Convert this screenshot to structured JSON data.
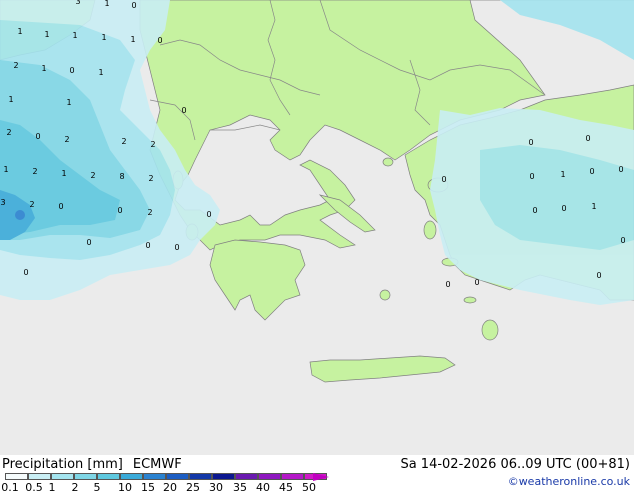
{
  "title": {
    "variable": "Precipitation [mm]",
    "model": "ECMWF"
  },
  "run_info": "Sa 14-02-2026 06..09 UTC (00+81)",
  "credit": "©weatheronline.co.uk",
  "legend": {
    "ticks": [
      "0.1",
      "0.5",
      "1",
      "2",
      "5",
      "10",
      "15",
      "20",
      "25",
      "30",
      "35",
      "40",
      "45",
      "50"
    ],
    "colors": [
      "#f5fbfc",
      "#c9eef4",
      "#a4e4ef",
      "#7fd6e6",
      "#5ec8df",
      "#3aaad9",
      "#2a82d0",
      "#1c5dc2",
      "#1238a8",
      "#0c1890",
      "#6a1ab0",
      "#8e18c0",
      "#b418c8",
      "#d018c8"
    ]
  },
  "map": {
    "colors": {
      "sea": "#ebebeb",
      "land": "#c6f2a0",
      "border": "#888888",
      "coast": "#808080"
    },
    "precip_values": [
      "3",
      "1",
      "0",
      "1",
      "1",
      "1",
      "1",
      "1",
      "0",
      "2",
      "1",
      "0",
      "1",
      "1",
      "1",
      "0",
      "2",
      "0",
      "2",
      "2",
      "2",
      "1",
      "2",
      "1",
      "2",
      "8",
      "2",
      "3",
      "2",
      "0",
      "0",
      "2",
      "0",
      "0",
      "0",
      "0",
      "0",
      "0",
      "1",
      "0",
      "0",
      "0",
      "0",
      "0",
      "0",
      "0",
      "1",
      "0",
      "0",
      "0",
      "0"
    ]
  }
}
